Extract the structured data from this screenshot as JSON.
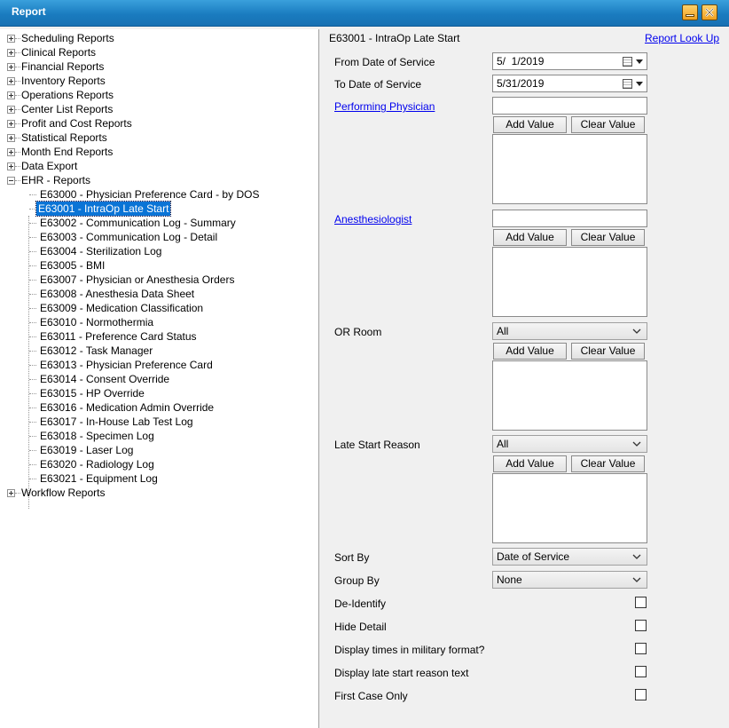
{
  "window": {
    "title": "Report"
  },
  "tree": {
    "top_nodes_before": [
      "Scheduling Reports",
      "Clinical Reports",
      "Financial Reports",
      "Inventory Reports",
      "Operations Reports",
      "Center List Reports",
      "Profit and Cost Reports",
      "Statistical Reports",
      "Month End Reports",
      "Data Export"
    ],
    "expanded_node": "EHR - Reports",
    "children": [
      "E63000 - Physician Preference Card - by DOS",
      "E63001 - IntraOp Late Start",
      "E63002 - Communication Log - Summary",
      "E63003 - Communication Log - Detail",
      "E63004 - Sterilization Log",
      "E63005 - BMI",
      "E63007 - Physician or Anesthesia Orders",
      "E63008 - Anesthesia Data Sheet",
      "E63009 - Medication Classification",
      "E63010 - Normothermia",
      "E63011 - Preference Card Status",
      "E63012 - Task Manager",
      "E63013 - Physician Preference Card",
      "E63014 - Consent Override",
      "E63015 - HP Override",
      "E63016 - Medication Admin Override",
      "E63017 - In-House Lab Test Log",
      "E63018 - Specimen Log",
      "E63019 - Laser Log",
      "E63020 - Radiology Log",
      "E63021 - Equipment Log"
    ],
    "selected_index": 1,
    "last_node": "Workflow Reports"
  },
  "report": {
    "title": "E63001 - IntraOp Late Start",
    "lookup_link": "Report Look Up",
    "from_date_label": "From Date of Service",
    "from_date_value": "5/  1/2019",
    "to_date_label": "To Date of Service",
    "to_date_value": "5/31/2019",
    "performing_physician_label": "Performing Physician",
    "anesthesiologist_label": "Anesthesiologist",
    "or_room_label": "OR Room",
    "or_room_value": "All",
    "late_start_reason_label": "Late Start Reason",
    "late_start_reason_value": "All",
    "add_value": "Add Value",
    "clear_value": "Clear Value",
    "sort_by_label": "Sort By",
    "sort_by_value": "Date of Service",
    "group_by_label": "Group By",
    "group_by_value": "None",
    "checkboxes": [
      {
        "label": "De-Identify",
        "checked": false
      },
      {
        "label": "Hide Detail",
        "checked": false
      },
      {
        "label": "Display times in military format?",
        "checked": false
      },
      {
        "label": "Display late start reason text",
        "checked": false
      },
      {
        "label": "First Case Only",
        "checked": false
      }
    ]
  }
}
